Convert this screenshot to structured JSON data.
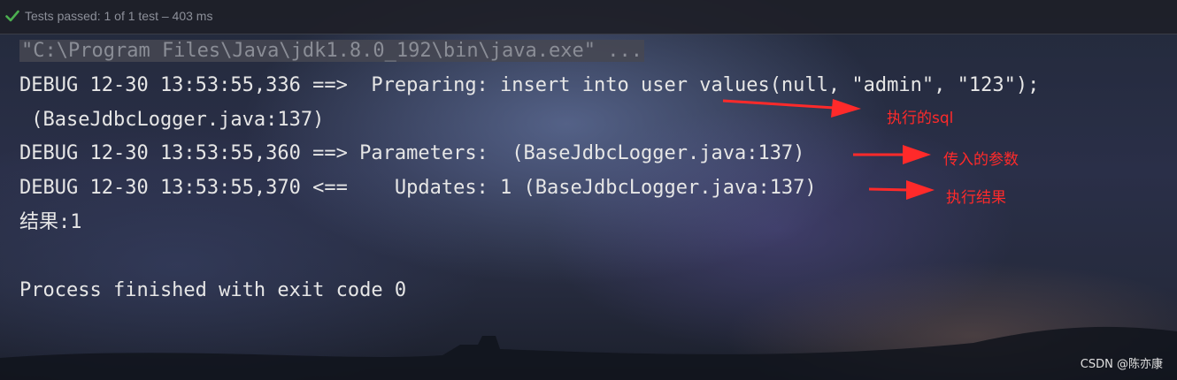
{
  "status": {
    "icon": "check-icon",
    "text": "Tests passed: 1 of 1 test – 403 ms",
    "color": "#4caf50"
  },
  "console": {
    "lines": [
      "\"C:\\Program Files\\Java\\jdk1.8.0_192\\bin\\java.exe\" ...",
      "DEBUG 12-30 13:53:55,336 ==>  Preparing: insert into user values(null, \"admin\", \"123\");",
      " (BaseJdbcLogger.java:137)",
      "DEBUG 12-30 13:53:55,360 ==> Parameters:  (BaseJdbcLogger.java:137)",
      "DEBUG 12-30 13:53:55,370 <==    Updates: 1 (BaseJdbcLogger.java:137)",
      "结果:1",
      "",
      "Process finished with exit code 0"
    ]
  },
  "annotations": [
    {
      "text": "执行的sql"
    },
    {
      "text": "传入的参数"
    },
    {
      "text": "执行结果"
    }
  ],
  "annotation_color": "#ff2a2a",
  "watermark": "CSDN @陈亦康"
}
